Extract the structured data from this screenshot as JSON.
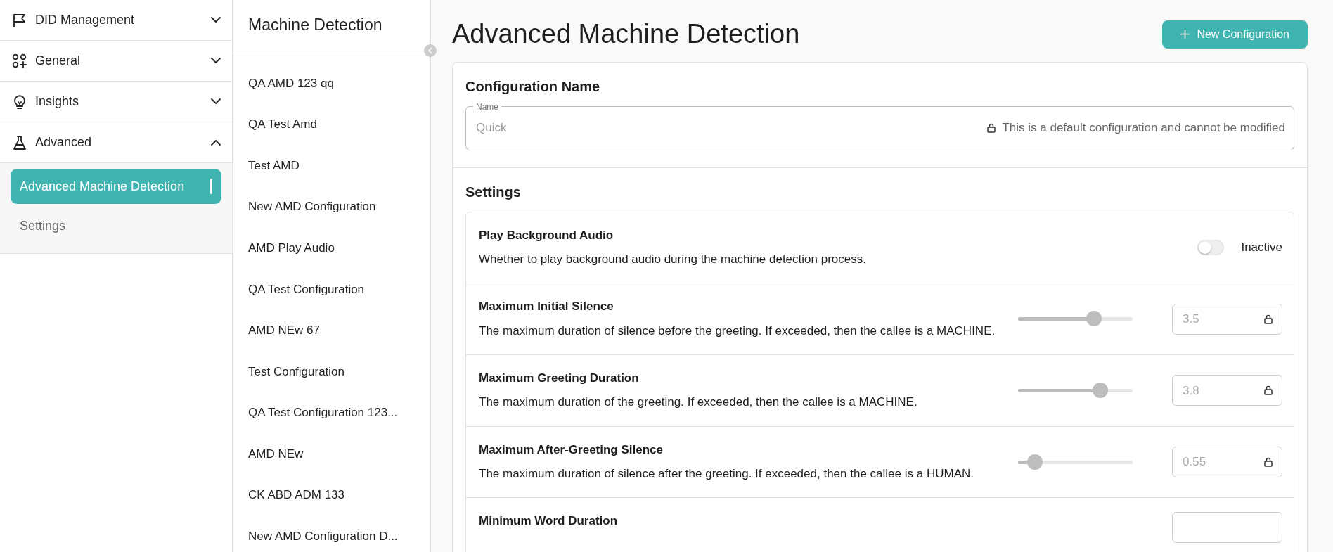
{
  "sidebar": {
    "groups": [
      {
        "label": "DID Management",
        "expanded": false
      },
      {
        "label": "General",
        "expanded": false
      },
      {
        "label": "Insights",
        "expanded": false
      },
      {
        "label": "Advanced",
        "expanded": true,
        "children": [
          {
            "label": "Advanced Machine Detection",
            "selected": true
          },
          {
            "label": "Settings",
            "selected": false
          }
        ]
      }
    ]
  },
  "config_list": {
    "title": "Machine Detection",
    "items": [
      {
        "label": "QA AMD 123 qq",
        "selected": false
      },
      {
        "label": "QA Test Amd",
        "selected": false
      },
      {
        "label": "Test AMD",
        "selected": false
      },
      {
        "label": "New AMD Configuration",
        "selected": false
      },
      {
        "label": "AMD Play Audio",
        "selected": false
      },
      {
        "label": "QA Test Configuration",
        "selected": false
      },
      {
        "label": "AMD NEw 67",
        "selected": false
      },
      {
        "label": "Test Configuration",
        "selected": false
      },
      {
        "label": "QA Test Configuration 123...",
        "selected": false
      },
      {
        "label": "AMD NEw",
        "selected": false
      },
      {
        "label": "CK ABD ADM 133",
        "selected": false
      },
      {
        "label": "New AMD Configuration D...",
        "selected": false
      }
    ]
  },
  "page": {
    "title": "Advanced Machine Detection",
    "new_button": "New Configuration",
    "name_section": {
      "heading": "Configuration Name",
      "field_label": "Name",
      "value": "Quick",
      "locked_note": "This is a default configuration and cannot be modified"
    },
    "settings": {
      "heading": "Settings",
      "rows": [
        {
          "kind": "toggle",
          "title": "Play Background Audio",
          "description": "Whether to play background audio during the machine detection process.",
          "on": false,
          "state_label": "Inactive"
        },
        {
          "kind": "slider",
          "title": "Maximum Initial Silence",
          "description": "The maximum duration of silence before the greeting. If exceeded, then the callee is a MACHINE.",
          "level": 0.66,
          "value": "3.5"
        },
        {
          "kind": "slider",
          "title": "Maximum Greeting Duration",
          "description": "The maximum duration of the greeting. If exceeded, then the callee is a MACHINE.",
          "level": 0.72,
          "value": "3.8"
        },
        {
          "kind": "slider",
          "title": "Maximum After-Greeting Silence",
          "description": "The maximum duration of silence after the greeting. If exceeded, then the callee is a HUMAN.",
          "level": 0.15,
          "value": "0.55"
        },
        {
          "kind": "cut",
          "title": "Minimum Word Duration"
        }
      ]
    }
  }
}
